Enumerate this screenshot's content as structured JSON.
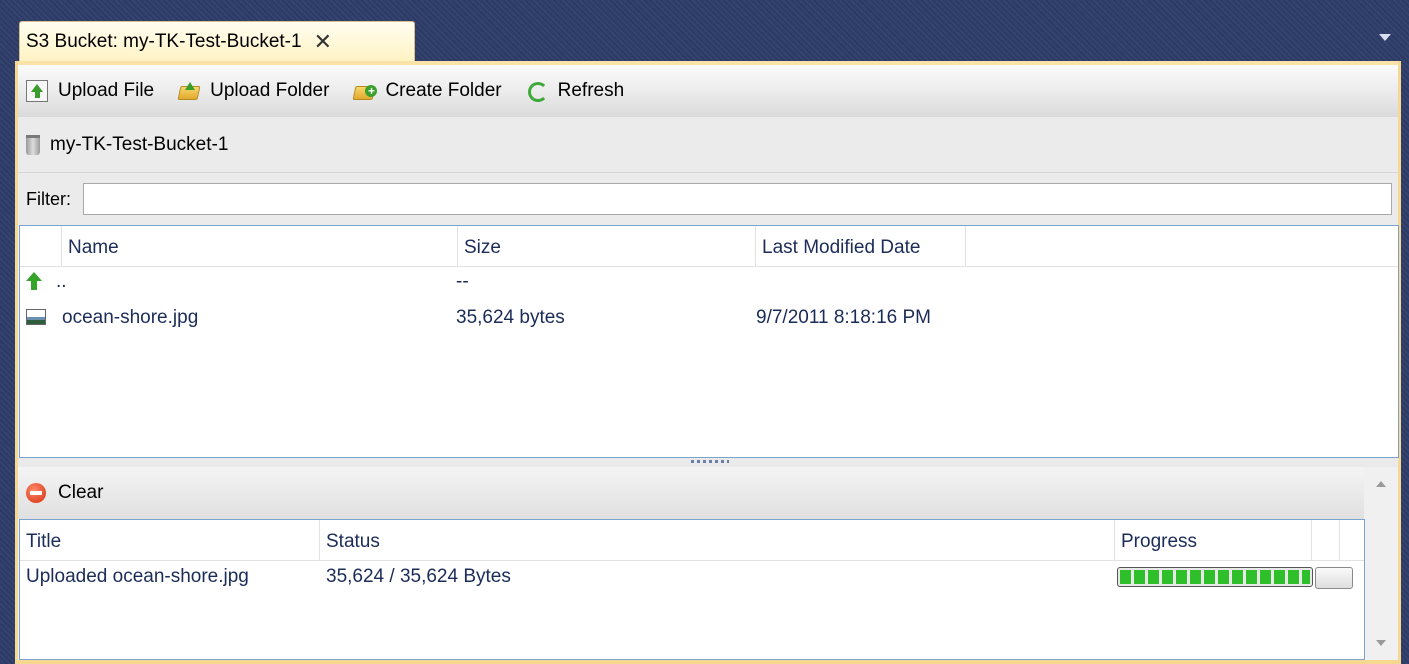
{
  "window": {
    "tab_title": "S3 Bucket: my-TK-Test-Bucket-1",
    "tab_close_glyph": "✕"
  },
  "toolbar": {
    "upload_file": "Upload File",
    "upload_folder": "Upload Folder",
    "create_folder": "Create Folder",
    "refresh": "Refresh"
  },
  "breadcrumb": {
    "bucket": "my-TK-Test-Bucket-1"
  },
  "filter": {
    "label": "Filter:",
    "value": "",
    "placeholder": ""
  },
  "file_list": {
    "columns": {
      "name": "Name",
      "size": "Size",
      "modified": "Last Modified Date"
    },
    "rows": [
      {
        "name": "..",
        "size": "--",
        "modified": "",
        "icon": "parent-folder-icon"
      },
      {
        "name": "ocean-shore.jpg",
        "size": "35,624 bytes",
        "modified": "9/7/2011 8:18:16 PM",
        "icon": "image-file-icon"
      }
    ]
  },
  "transfers": {
    "clear_label": "Clear",
    "columns": {
      "title": "Title",
      "status": "Status",
      "progress": "Progress"
    },
    "rows": [
      {
        "title": "Uploaded ocean-shore.jpg",
        "status": "35,624 / 35,624 Bytes",
        "progress_percent": 100
      }
    ]
  },
  "colors": {
    "accent_tab": "#fff3c4",
    "border_highlight": "#f6d890",
    "list_border": "#7aa3d0",
    "text_link": "#1b2c58",
    "progress_green": "#2fbf2a"
  }
}
